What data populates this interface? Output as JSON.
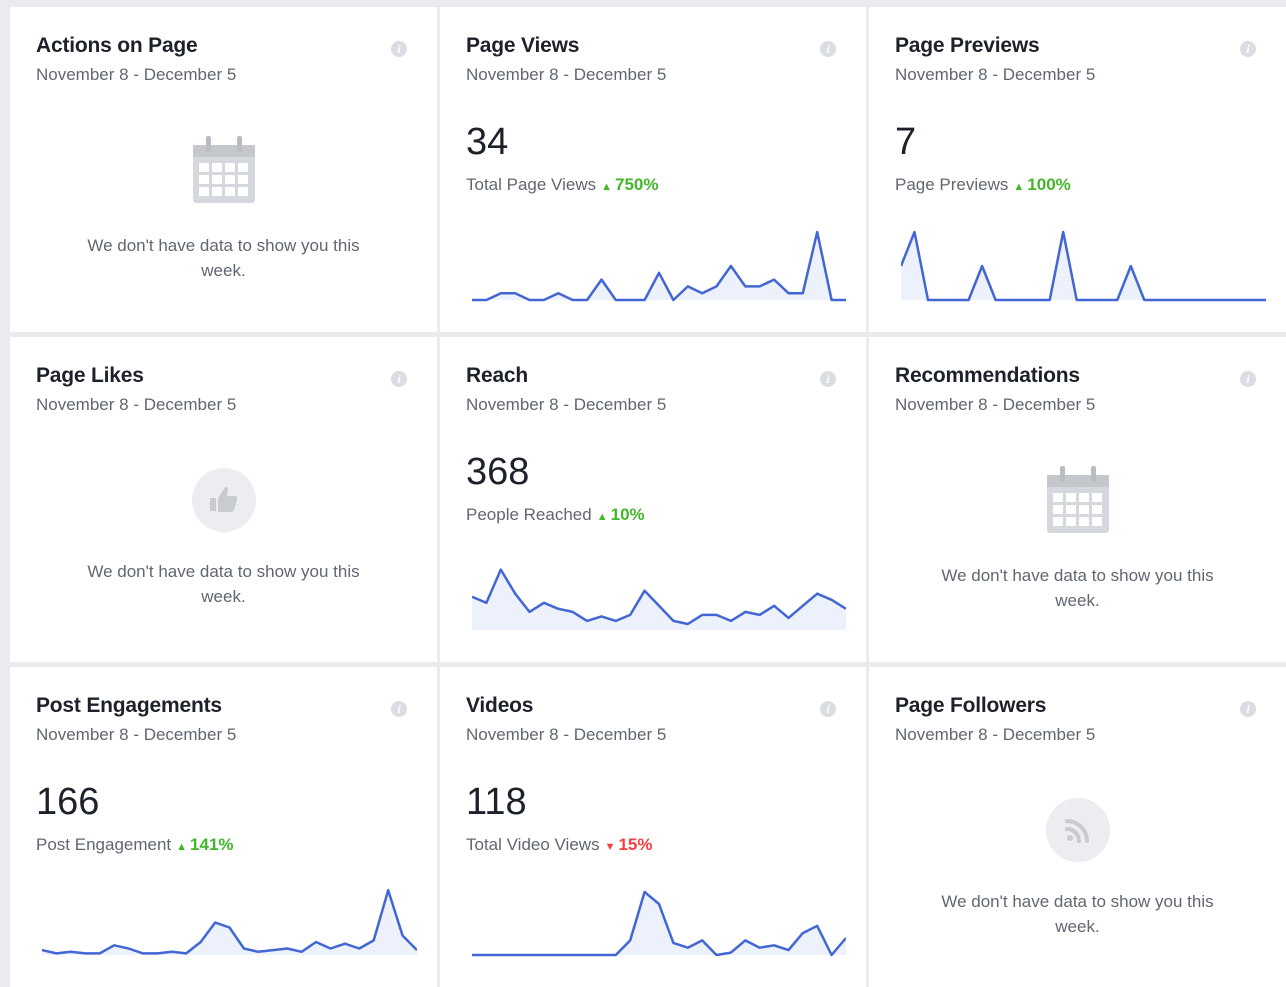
{
  "cards": [
    {
      "title": "Actions on Page",
      "date": "November 8 - December 5",
      "info_icon": "info-icon",
      "empty_icon": "calendar-icon",
      "empty_message": "We don't have data to show you this week."
    },
    {
      "title": "Page Views",
      "date": "November 8 - December 5",
      "info_icon": "info-icon",
      "value": "34",
      "metric_label": "Total Page Views",
      "change": "750%",
      "trend": "up",
      "chart_data": {
        "type": "area",
        "values": [
          0,
          0,
          1,
          1,
          0,
          0,
          1,
          0,
          0,
          3,
          0,
          0,
          0,
          4,
          0,
          2,
          1,
          2,
          5,
          2,
          2,
          3,
          1,
          1,
          10,
          0,
          0
        ],
        "ylim": [
          0,
          10
        ]
      }
    },
    {
      "title": "Page Previews",
      "date": "November 8 - December 5",
      "info_icon": "info-icon",
      "value": "7",
      "metric_label": "Page Previews",
      "change": "100%",
      "trend": "up",
      "chart_data": {
        "type": "area",
        "values": [
          1,
          2,
          0,
          0,
          0,
          0,
          1,
          0,
          0,
          0,
          0,
          0,
          2,
          0,
          0,
          0,
          0,
          1,
          0,
          0,
          0,
          0,
          0,
          0,
          0,
          0,
          0,
          0
        ],
        "ylim": [
          0,
          2
        ]
      }
    },
    {
      "title": "Page Likes",
      "date": "November 8 - December 5",
      "info_icon": "info-icon",
      "empty_icon": "thumbs-up-icon",
      "empty_message": "We don't have data to show you this week."
    },
    {
      "title": "Reach",
      "date": "November 8 - December 5",
      "info_icon": "info-icon",
      "value": "368",
      "metric_label": "People Reached",
      "change": "10%",
      "trend": "up",
      "chart_data": {
        "type": "area",
        "values": [
          22,
          18,
          40,
          24,
          12,
          18,
          14,
          12,
          6,
          9,
          6,
          10,
          26,
          16,
          6,
          4,
          10,
          10,
          6,
          12,
          10,
          16,
          8,
          16,
          24,
          20,
          14
        ],
        "ylim": [
          0,
          45
        ]
      }
    },
    {
      "title": "Recommendations",
      "date": "November 8 - December 5",
      "info_icon": "info-icon",
      "empty_icon": "calendar-icon",
      "empty_message": "We don't have data to show you this week."
    },
    {
      "title": "Post Engagements",
      "date": "November 8 - December 5",
      "info_icon": "info-icon",
      "value": "166",
      "metric_label": "Post Engagement",
      "change": "141%",
      "trend": "up",
      "chart_data": {
        "type": "area",
        "values": [
          3,
          1,
          2,
          1,
          1,
          6,
          4,
          1,
          1,
          2,
          1,
          8,
          20,
          17,
          4,
          2,
          3,
          4,
          2,
          8,
          4,
          7,
          4,
          9,
          40,
          12,
          3
        ],
        "ylim": [
          0,
          42
        ]
      }
    },
    {
      "title": "Videos",
      "date": "November 8 - December 5",
      "info_icon": "info-icon",
      "value": "118",
      "metric_label": "Total Video Views",
      "change": "15%",
      "trend": "down",
      "chart_data": {
        "type": "area",
        "values": [
          0,
          0,
          0,
          0,
          0,
          0,
          0,
          0,
          0,
          0,
          0,
          6,
          26,
          21,
          5,
          3,
          6,
          0,
          1,
          6,
          3,
          4,
          2,
          9,
          12,
          0,
          7
        ],
        "ylim": [
          0,
          28
        ]
      }
    },
    {
      "title": "Page Followers",
      "date": "November 8 - December 5",
      "info_icon": "info-icon",
      "empty_icon": "rss-icon",
      "empty_message": "We don't have data to show you this week."
    }
  ]
}
